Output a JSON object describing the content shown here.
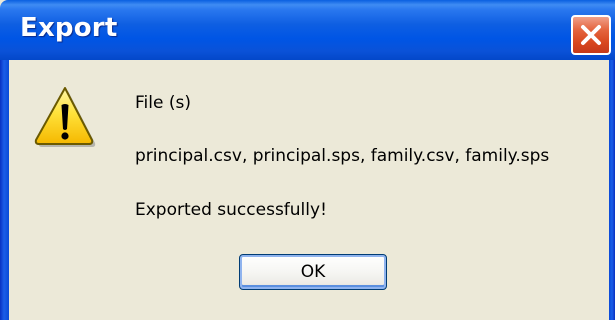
{
  "dialog": {
    "title": "Export",
    "icon": "warning-icon",
    "message_line_1": "File (s)",
    "message_line_2": "principal.csv, principal.sps, family.csv, family.sps",
    "message_line_3": "Exported successfully!",
    "ok_label": "OK",
    "close_icon": "close-icon"
  },
  "colors": {
    "titlebar": "#0055e5",
    "close_button": "#d9481f",
    "dialog_background": "#ece9d8",
    "warning_fill": "#ffd21f"
  }
}
